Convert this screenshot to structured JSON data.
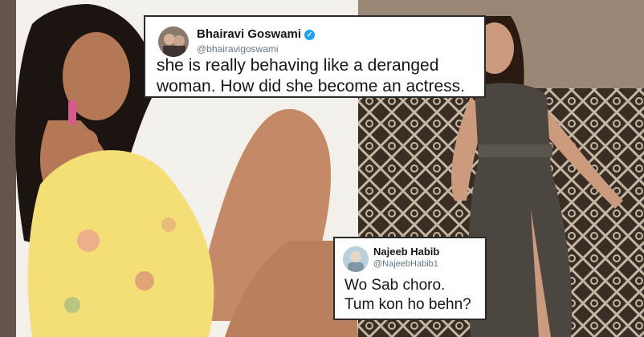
{
  "tweets": {
    "top": {
      "name": "Bhairavi Goswami",
      "handle": "@bhairavigoswami",
      "verified_icon": "verified-badge-icon",
      "text_line1": "she is really behaving like a deranged",
      "text_line2": "woman. How did she become an actress."
    },
    "bottom": {
      "name": "Najeeb Habib",
      "handle": "@NajeebHabib1",
      "text_line1": "Wo Sab choro.",
      "text_line2": "Tum kon ho behn?"
    }
  },
  "colors": {
    "verified": "#1da1f2",
    "handle": "#657786",
    "tweet_border": "#2a2a2a"
  }
}
